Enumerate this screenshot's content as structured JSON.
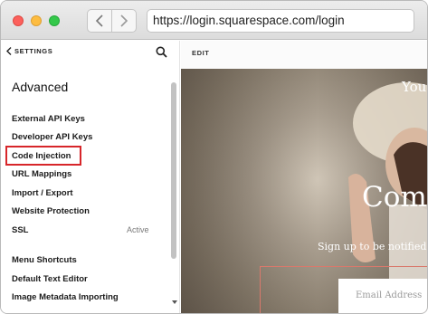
{
  "browser": {
    "url": "https://login.squarespace.com/login",
    "back_icon": "chevron-left-icon",
    "forward_icon": "chevron-right-icon"
  },
  "sidebar": {
    "back_label": "SETTINGS",
    "title": "Advanced",
    "items": [
      {
        "label": "External API Keys"
      },
      {
        "label": "Developer API Keys"
      },
      {
        "label": "Code Injection",
        "highlighted": true
      },
      {
        "label": "URL Mappings"
      },
      {
        "label": "Import / Export"
      },
      {
        "label": "Website Protection"
      },
      {
        "label": "SSL",
        "status": "Active"
      },
      {
        "label": "Menu Shortcuts"
      },
      {
        "label": "Default Text Editor"
      },
      {
        "label": "Image Metadata Importing"
      }
    ],
    "highlight_color": "#d7262a"
  },
  "editor": {
    "edit_label": "EDIT",
    "preview": {
      "heading_top": "You",
      "heading_big": "Comi",
      "subtext": "Sign up to be notified w",
      "email_placeholder": "Email Address"
    }
  }
}
